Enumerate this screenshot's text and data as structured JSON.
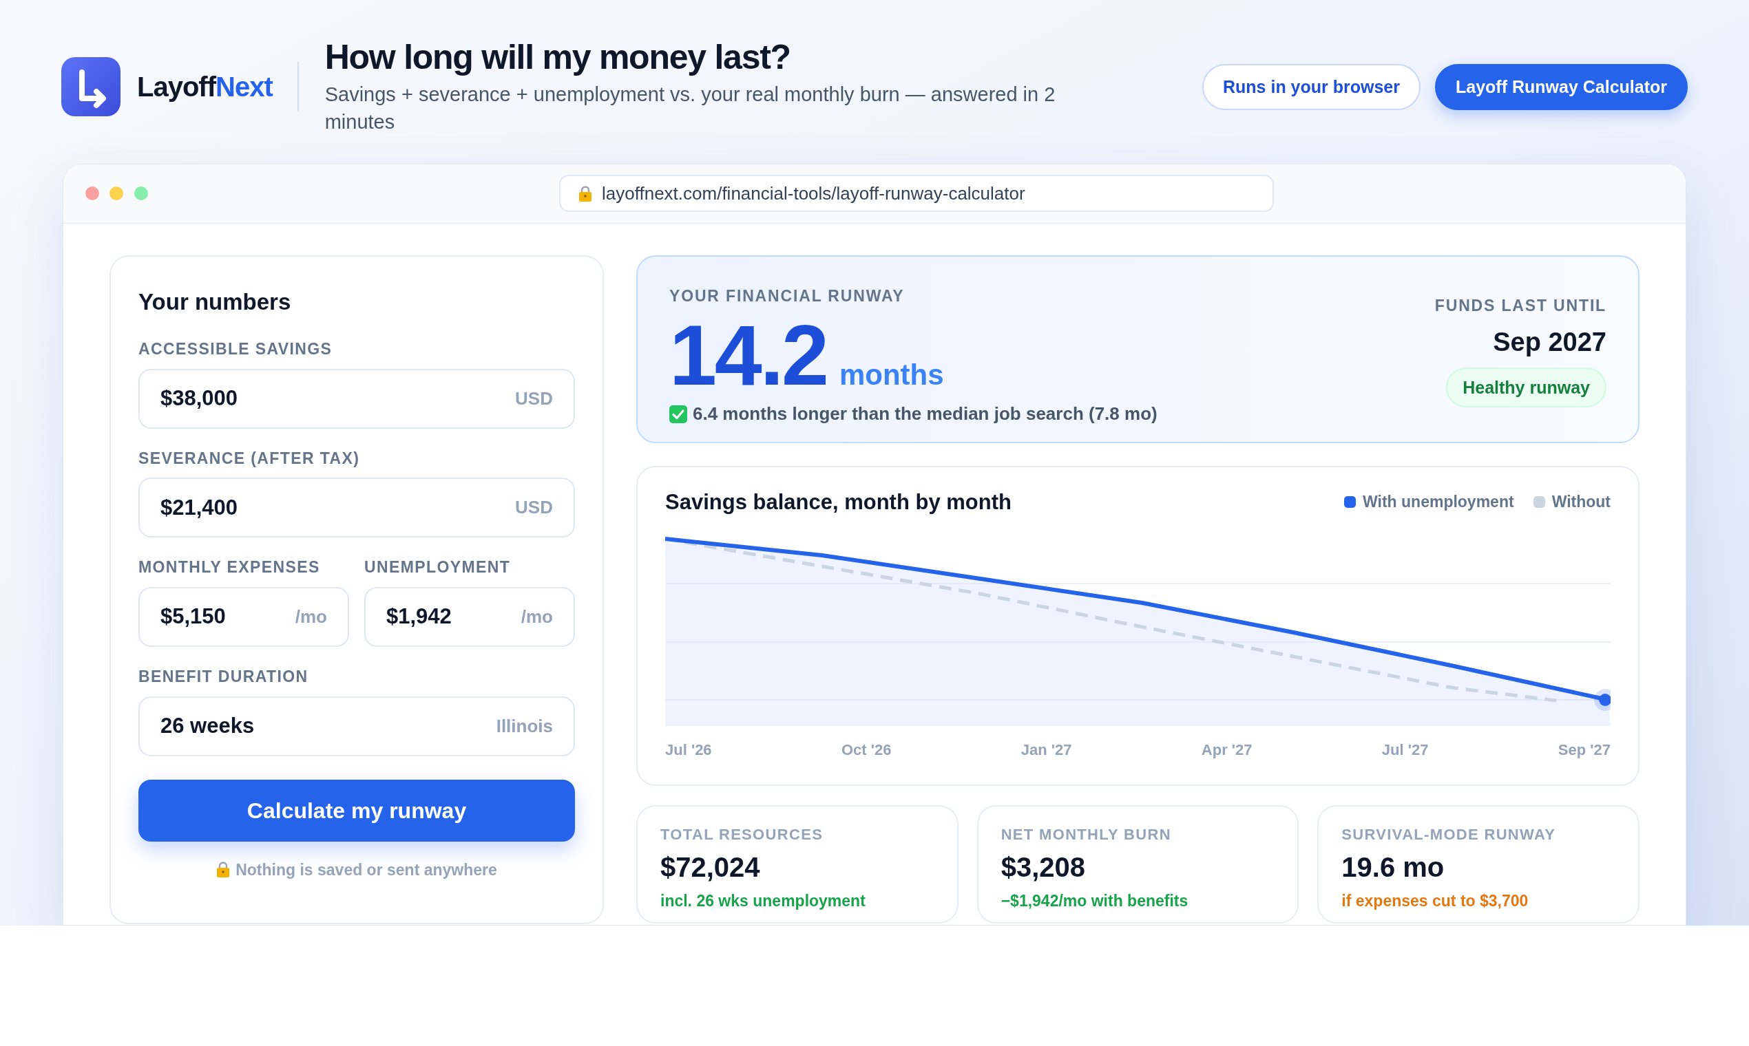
{
  "brand": {
    "name": "Layoff",
    "accent": "Next"
  },
  "header": {
    "title": "How long will my money last?",
    "subtitle": "Savings + severance + unemployment vs. your real monthly burn — answered in 2 minutes"
  },
  "header_buttons": [
    {
      "label": "Runs in your browser",
      "kind": "outline"
    },
    {
      "label": "Layoff Runway Calculator",
      "kind": "filled"
    }
  ],
  "browser": {
    "url": "layoffnext.com/financial-tools/layoff-runway-calculator"
  },
  "inputs_panel": {
    "title": "Your numbers",
    "field_rows": [
      [
        {
          "label": "ACCESSIBLE SAVINGS",
          "value": "$38,000",
          "suffix": "USD"
        }
      ],
      [
        {
          "label": "SEVERANCE (AFTER TAX)",
          "value": "$21,400",
          "suffix": "USD"
        }
      ],
      [
        {
          "label": "MONTHLY EXPENSES",
          "value": "$5,150",
          "suffix": "/mo"
        },
        {
          "label": "UNEMPLOYMENT",
          "value": "$1,942",
          "suffix": "/mo"
        }
      ],
      [
        {
          "label": "BENEFIT DURATION",
          "value": "26 weeks",
          "suffix": "Illinois"
        }
      ]
    ],
    "button": "Calculate my runway",
    "privacy_note": "Nothing is saved or sent anywhere"
  },
  "runway": {
    "label": "YOUR FINANCIAL RUNWAY",
    "value": "14.2",
    "unit": "months",
    "comparison": "6.4 months longer than the median job search (7.8 mo)",
    "until_label": "FUNDS LAST UNTIL",
    "until_value": "Sep 2027",
    "status": {
      "label": "Healthy runway",
      "color": "#15803d"
    }
  },
  "chart": {
    "title": "Savings balance, month by month",
    "legend": [
      {
        "label": "With unemployment",
        "color": "#2563eb"
      },
      {
        "label": "Without",
        "color": "#cbd5e1"
      }
    ],
    "x_labels": [
      "Jul '26",
      "Oct '26",
      "Jan '27",
      "Apr '27",
      "Jul '27",
      "Sep '27"
    ]
  },
  "stats": [
    {
      "label": "TOTAL RESOURCES",
      "value": "$72,024",
      "note": "incl. 26 wks unemployment",
      "color": "#16a34a"
    },
    {
      "label": "NET MONTHLY BURN",
      "value": "$3,208",
      "note": "−$1,942/mo with benefits",
      "color": "#16a34a"
    },
    {
      "label": "SURVIVAL-MODE RUNWAY",
      "value": "19.6 mo",
      "note": "if expenses cut to $3,700",
      "color": "#e2780f"
    }
  ]
}
